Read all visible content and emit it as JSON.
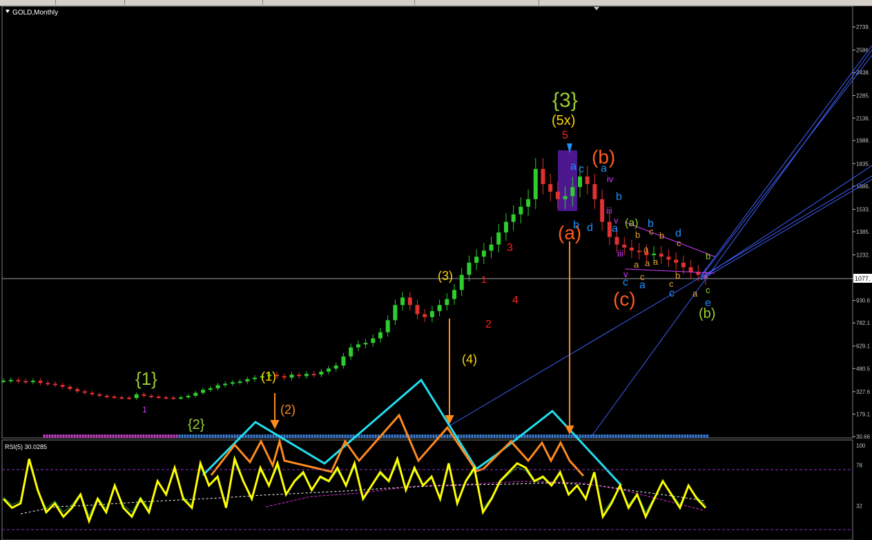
{
  "window": {
    "title": "GOLD,Monthly"
  },
  "main_panel": {
    "price_scale": [
      "2739.",
      "2586.",
      "2438.",
      "2285.",
      "2136.",
      "1988.",
      "1835.",
      "1686.",
      "1533.",
      "1385.",
      "1232.",
      "1077.",
      "930.6",
      "782.1",
      "629.1",
      "480.5",
      "327.6",
      "179.1",
      "30.66"
    ],
    "current_price_label": "1077."
  },
  "rsi_panel": {
    "title": "RSI(5) 30.0285",
    "scale": [
      "100",
      "78",
      "32"
    ]
  },
  "wave_labels": {
    "w_1_curly": "{1}",
    "w_2_curly": "{2}",
    "w_3_curly": "{3}",
    "w_p1": "(1)",
    "w_p2": "(2)",
    "w_p3": "(3)",
    "w_p4": "(4)",
    "w_5x": "(5x)",
    "w_a_big": "(a)",
    "w_b_big": "(b)",
    "w_c_big": "(c)",
    "w_b_small": "(b)",
    "w_a_small": "(a)",
    "r1": "1",
    "r2": "2",
    "r3": "3",
    "r4": "4",
    "r5": "5",
    "b_a1": "a",
    "b_c1": "c",
    "b_b1": "b",
    "b_d1": "d",
    "b_a2": "a",
    "b_b2": "b",
    "b_a3": "a",
    "b_a4": "a",
    "b_c2": "c",
    "b_c3": "c",
    "b_b3": "b",
    "b_d2": "d",
    "b_e1": "e",
    "m_iv": "iv",
    "m_iii1": "iii",
    "m_v1": "v",
    "m_iii2": "iii",
    "m_v2": "v",
    "o_a1": "a",
    "o_b1": "b",
    "o_a2": "a",
    "o_a3": "a",
    "o_c1": "c",
    "o_c2": "c",
    "o_b2": "b",
    "o_a4": "a",
    "o_b3": "b",
    "o_c3": "c",
    "o_a5": "a",
    "o_c4": "c",
    "g_b": "b",
    "g_c": "c",
    "i_1": "1"
  },
  "colors": {
    "background": "#000000",
    "bull_candle": "#2ecc2e",
    "bear_candle": "#e03030",
    "rsi_line": "#ffff00",
    "cyan_zigzag": "#22e0f0",
    "orange_zigzag": "#ff8a1e",
    "trendline": "#4060ff",
    "grid_text": "#c0c0c0",
    "wave_green": "#9acd32",
    "wave_yellow": "#ffd700",
    "wave_orange": "#ff5a1e",
    "wave_red": "#ff2020",
    "wave_blue": "#1e90ff",
    "wave_magenta": "#d43cff"
  },
  "chart_data": [
    {
      "type": "line",
      "title": "GOLD,Monthly",
      "ylim": [
        30.66,
        2739
      ],
      "y_ticks": [
        2739,
        2586,
        2438,
        2285,
        2136,
        1988,
        1835,
        1686,
        1533,
        1385,
        1232,
        1077,
        930.6,
        782.1,
        629.1,
        480.5,
        327.6,
        179.1,
        30.66
      ],
      "series": [
        {
          "values": [
            400,
            405,
            398,
            392,
            400,
            385,
            380,
            372,
            360,
            345,
            330,
            320,
            310,
            300,
            295,
            290,
            288,
            285,
            310,
            300,
            295,
            290,
            288,
            285,
            290,
            300,
            320,
            340,
            350,
            370,
            380,
            390,
            395,
            410,
            420,
            430,
            440,
            430,
            420,
            440,
            430,
            445,
            440,
            460,
            480,
            500,
            560,
            620,
            640,
            650,
            680,
            720,
            800,
            900,
            950,
            900,
            840,
            820,
            860,
            900,
            940,
            1000,
            1100,
            1180,
            1220,
            1260,
            1300,
            1380,
            1450,
            1500,
            1550,
            1600,
            1800,
            1700,
            1650,
            1600,
            1620,
            1680,
            1750,
            1700,
            1600,
            1450,
            1350,
            1300,
            1280,
            1260,
            1250,
            1230,
            1240,
            1220,
            1200,
            1180,
            1150,
            1120,
            1100,
            1077
          ]
        }
      ]
    },
    {
      "type": "line",
      "title": "RSI(5) 30.0285",
      "ylim": [
        0,
        100
      ],
      "y_ticks": [
        100,
        78,
        32
      ],
      "series": [
        {
          "values": [
            40,
            30,
            35,
            85,
            50,
            25,
            35,
            20,
            30,
            45,
            15,
            40,
            25,
            55,
            30,
            20,
            40,
            25,
            60,
            45,
            75,
            40,
            30,
            80,
            55,
            65,
            30,
            85,
            60,
            40,
            75,
            55,
            80,
            45,
            60,
            70,
            50,
            65,
            60,
            75,
            55,
            80,
            40,
            55,
            70,
            60,
            85,
            50,
            75,
            55,
            65,
            40,
            80,
            35,
            60,
            75,
            25,
            40,
            60,
            70,
            80,
            75,
            60,
            65,
            55,
            70,
            45,
            55,
            40,
            70,
            20,
            35,
            55,
            30,
            45,
            20,
            40,
            60,
            45,
            30,
            55,
            40,
            30
          ]
        }
      ]
    }
  ]
}
